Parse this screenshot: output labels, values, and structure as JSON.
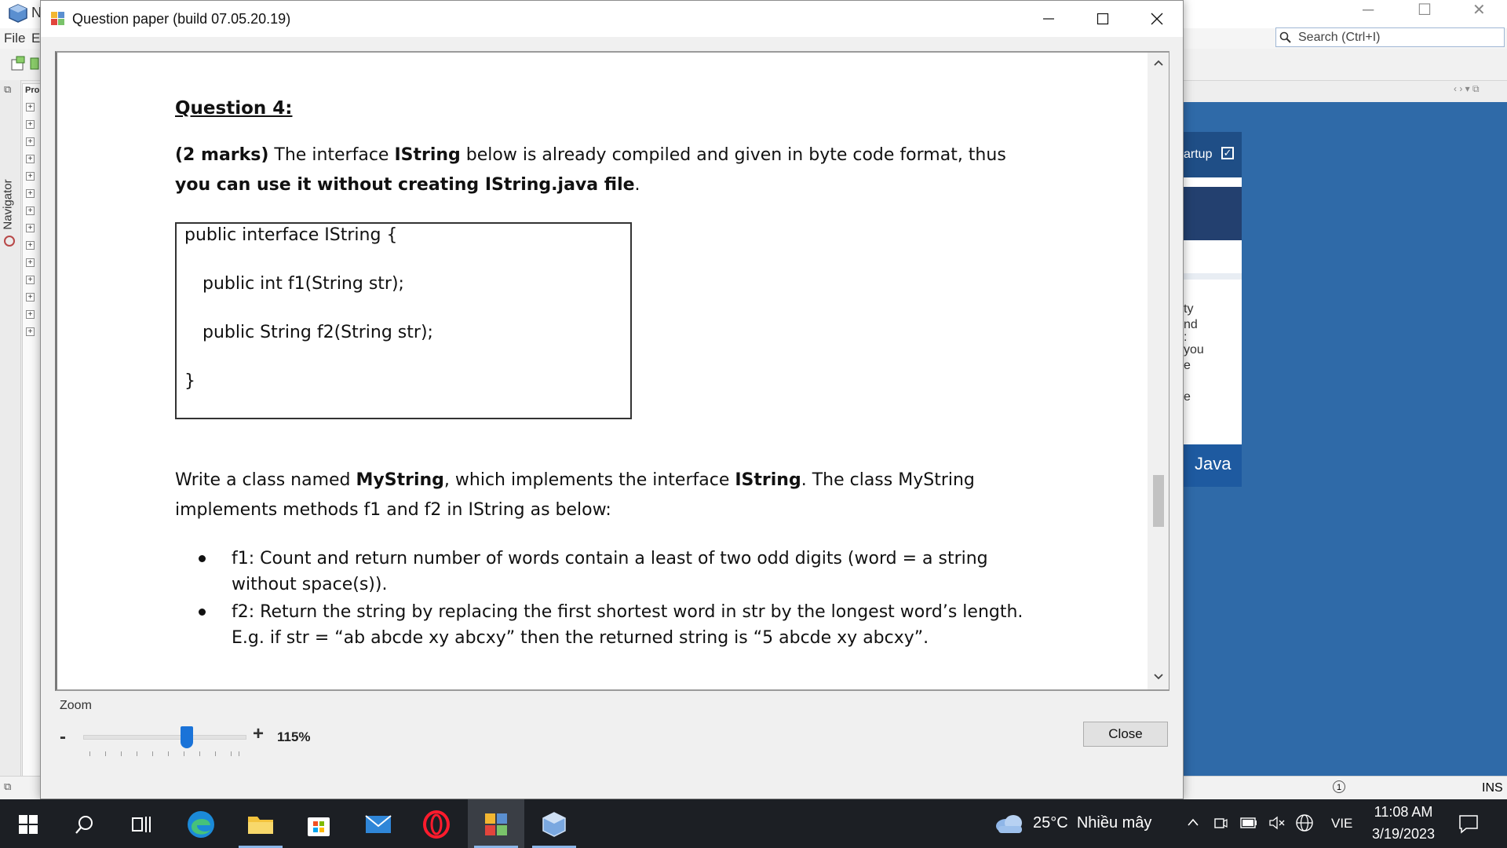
{
  "background_app": {
    "title_initial": "N",
    "menu": {
      "file": "File",
      "edit": "E"
    },
    "search_placeholder": "Search (Ctrl+I)",
    "navigator_label": "Navigator",
    "projects_tab": "Pro",
    "start_page": {
      "startup_label": "artup",
      "text_lines": [
        "ty",
        "nd",
        ":",
        "you",
        "e",
        "",
        "e"
      ],
      "java_logo": "Java"
    },
    "status": {
      "mode": "INS"
    }
  },
  "dialog": {
    "title": "Question paper (build 07.05.20.19)",
    "document": {
      "heading": "Question 4:",
      "intro": {
        "marks": "(2 marks)",
        "t1": " The interface ",
        "b1": "IString",
        "t2": " below is already compiled and given in byte code format, thus ",
        "b2": "you can use it without creating IString.java file",
        "t3": "."
      },
      "code": [
        "public interface IString {",
        "public int f1(String str);",
        "public String f2(String str);",
        "}"
      ],
      "task": {
        "t1": "Write a class named ",
        "b1": "MyString",
        "t2": ", which implements the interface ",
        "b2": "IString",
        "t3": ". The class MyString implements methods  f1 and f2 in IString as below:"
      },
      "bullets": [
        "f1: Count and return number of words contain a least of two odd digits (word = a string without space(s)).",
        "f2: Return the string by replacing the first shortest word in str by the longest word’s length. E.g. if str = “ab abcde xy abcxy” then the returned string is “5 abcde xy abcxy”."
      ]
    },
    "zoom": {
      "label": "Zoom",
      "minus": "-",
      "plus": "+",
      "value": "115%",
      "level_percent": 115
    },
    "close_label": "Close"
  },
  "taskbar": {
    "weather_temp": "25°C",
    "weather_desc": "Nhiều mây",
    "language": "VIE",
    "time": "11:08 AM",
    "date": "3/19/2023"
  }
}
